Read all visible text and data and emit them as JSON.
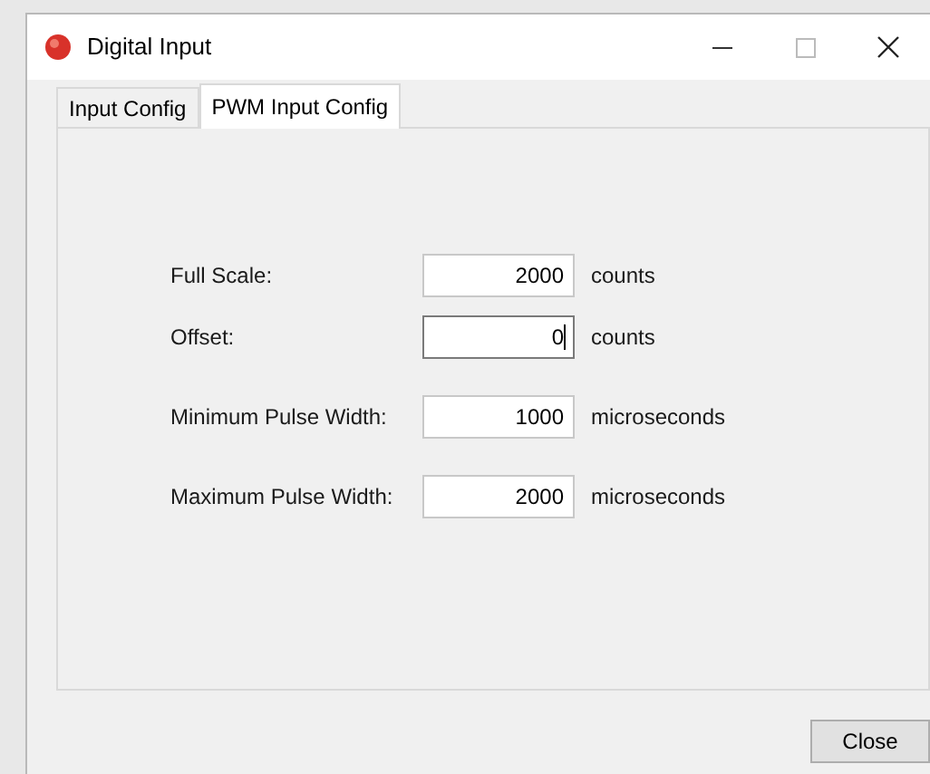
{
  "window": {
    "title": "Digital Input"
  },
  "tabs": [
    {
      "label": "Input Config",
      "selected": false
    },
    {
      "label": "PWM Input Config",
      "selected": true
    }
  ],
  "fields": [
    {
      "label": "Full Scale:",
      "value": "2000",
      "unit": "counts",
      "focused": false
    },
    {
      "label": "Offset:",
      "value": "0",
      "unit": "counts",
      "focused": true
    },
    {
      "label": "Minimum Pulse Width:",
      "value": "1000",
      "unit": "microseconds",
      "focused": false
    },
    {
      "label": "Maximum Pulse Width:",
      "value": "2000",
      "unit": "microseconds",
      "focused": false
    }
  ],
  "buttons": [
    {
      "label": "Close"
    }
  ]
}
